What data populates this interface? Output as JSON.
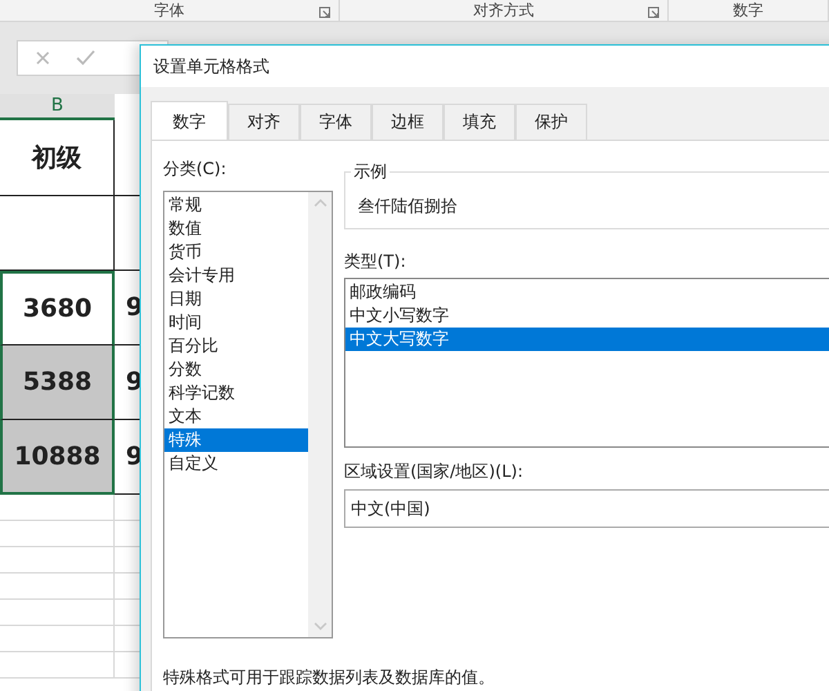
{
  "ribbon": {
    "groups": [
      {
        "label": "字体",
        "launcher": true
      },
      {
        "label": "对齐方式",
        "launcher": true
      },
      {
        "label": "数字"
      }
    ]
  },
  "sheet": {
    "column_header": "B",
    "rows": [
      {
        "cells": [
          "初级",
          ""
        ],
        "shaded": false,
        "selected": false
      },
      {
        "cells": [
          "",
          ""
        ],
        "shaded": false,
        "selected": false
      },
      {
        "cells": [
          "3680",
          "9"
        ],
        "shaded": false,
        "selected": true
      },
      {
        "cells": [
          "5388",
          "9"
        ],
        "shaded": true,
        "selected": true
      },
      {
        "cells": [
          "10888",
          "9"
        ],
        "shaded": true,
        "selected": true
      }
    ]
  },
  "dialog": {
    "title": "设置单元格格式",
    "tabs": [
      {
        "label": "数字",
        "selected": true
      },
      {
        "label": "对齐",
        "selected": false
      },
      {
        "label": "字体",
        "selected": false
      },
      {
        "label": "边框",
        "selected": false
      },
      {
        "label": "填充",
        "selected": false
      },
      {
        "label": "保护",
        "selected": false
      }
    ],
    "category_label": "分类(C):",
    "categories": [
      {
        "label": "常规",
        "selected": false
      },
      {
        "label": "数值",
        "selected": false
      },
      {
        "label": "货币",
        "selected": false
      },
      {
        "label": "会计专用",
        "selected": false
      },
      {
        "label": "日期",
        "selected": false
      },
      {
        "label": "时间",
        "selected": false
      },
      {
        "label": "百分比",
        "selected": false
      },
      {
        "label": "分数",
        "selected": false
      },
      {
        "label": "科学记数",
        "selected": false
      },
      {
        "label": "文本",
        "selected": false
      },
      {
        "label": "特殊",
        "selected": true
      },
      {
        "label": "自定义",
        "selected": false
      }
    ],
    "sample": {
      "legend": "示例",
      "value": "叁仟陆佰捌拾"
    },
    "type_label": "类型(T):",
    "types": [
      {
        "label": "邮政编码",
        "selected": false
      },
      {
        "label": "中文小写数字",
        "selected": false
      },
      {
        "label": "中文大写数字",
        "selected": true
      }
    ],
    "locale_label": "区域设置(国家/地区)(L):",
    "locale_value": "中文(中国)",
    "description": "特殊格式可用于跟踪数据列表及数据库的值。"
  }
}
